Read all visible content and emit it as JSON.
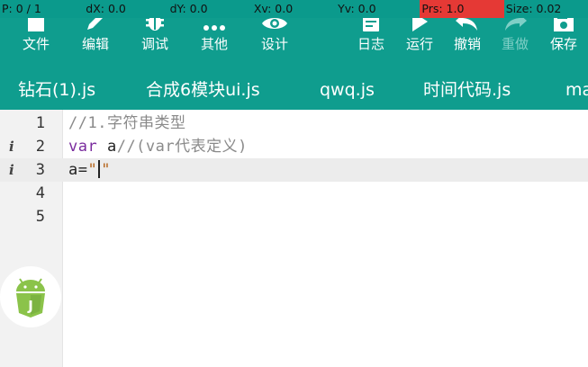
{
  "debug": {
    "p": "P: 0 / 1",
    "dx": "dX: 0.0",
    "dy": "dY: 0.0",
    "xv": "Xv: 0.0",
    "yv": "Yv: 0.0",
    "prs": "Prs: 1.0",
    "size": "Size: 0.02",
    "alert_color": "#e53935"
  },
  "toolbar": {
    "file": "文件",
    "edit": "编辑",
    "debug": "调试",
    "other": "其他",
    "design": "设计",
    "log": "日志",
    "run": "运行",
    "undo": "撤销",
    "redo": "重做",
    "save": "保存",
    "icons": [
      "file-icon",
      "pencil-icon",
      "bug-icon",
      "more-icon",
      "eye-icon",
      "log-icon",
      "play-icon",
      "undo-icon",
      "redo-icon",
      "save-icon"
    ],
    "color": "#0f9d8e"
  },
  "tabs": [
    "钻石(1).js",
    "合成6模块ui.js",
    "qwq.js",
    "时间代码.js",
    "ma"
  ],
  "editor": {
    "lines": [
      {
        "number": "1",
        "text": "//1.字符串类型"
      },
      {
        "number": "2",
        "info": "i",
        "keyword": "var",
        "rest": " a",
        "comment": "//(var代表定义)"
      },
      {
        "number": "3",
        "info": "i",
        "before": "a=",
        "quote_open": "\"",
        "quote_close": "\""
      },
      {
        "number": "4"
      },
      {
        "number": "5"
      }
    ],
    "current_line": 3
  },
  "badge": {
    "icon": "android-js-icon",
    "letter": "J"
  }
}
